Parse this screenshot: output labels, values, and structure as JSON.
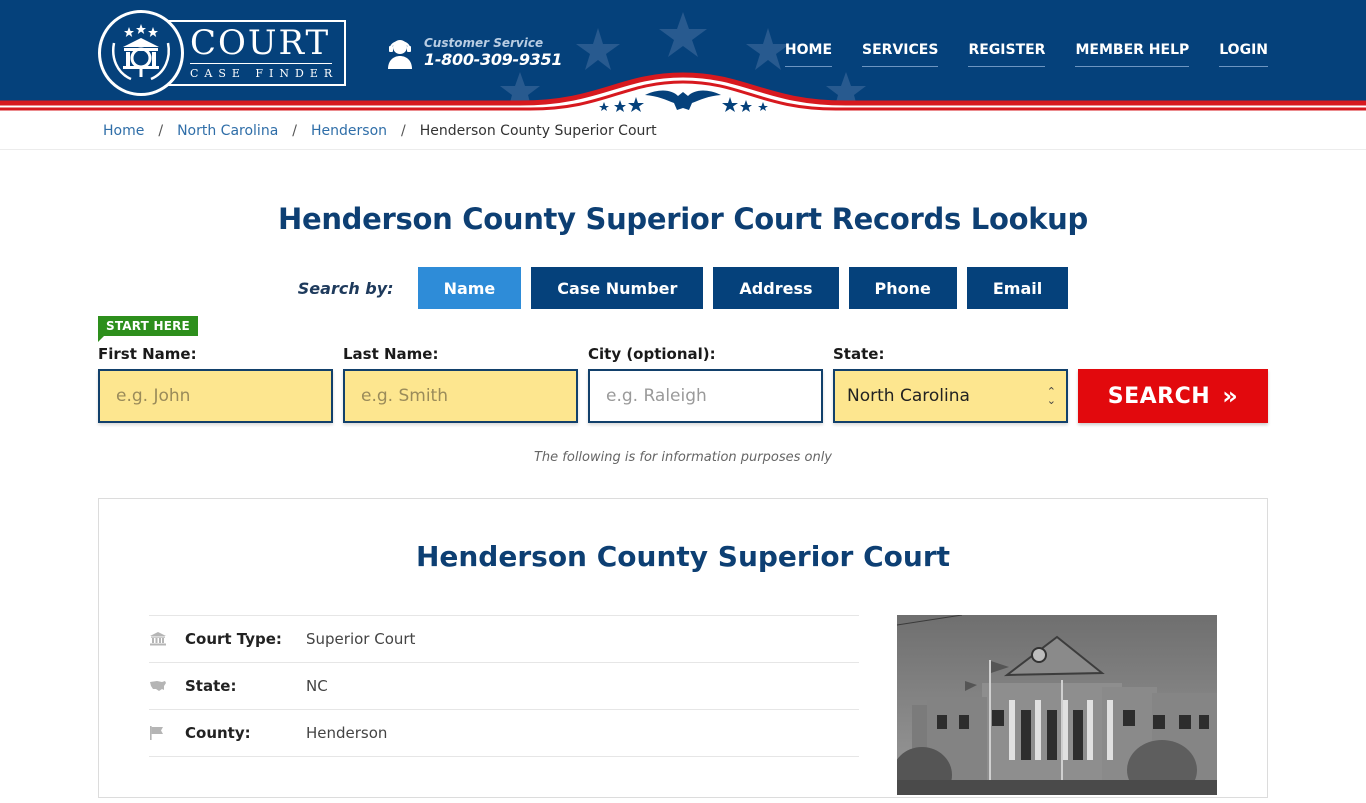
{
  "header": {
    "logo": {
      "title": "COURT",
      "subtitle": "CASE FINDER"
    },
    "customer_service": {
      "label": "Customer Service",
      "phone": "1-800-309-9351"
    },
    "nav": [
      {
        "label": "HOME"
      },
      {
        "label": "SERVICES"
      },
      {
        "label": "REGISTER"
      },
      {
        "label": "MEMBER HELP"
      },
      {
        "label": "LOGIN"
      }
    ]
  },
  "breadcrumb": [
    {
      "label": "Home"
    },
    {
      "label": "North Carolina"
    },
    {
      "label": "Henderson"
    },
    {
      "label": "Henderson County Superior Court"
    }
  ],
  "page_title": "Henderson County Superior Court Records Lookup",
  "search": {
    "search_by_label": "Search by:",
    "tabs": [
      {
        "label": "Name",
        "active": true
      },
      {
        "label": "Case Number",
        "active": false
      },
      {
        "label": "Address",
        "active": false
      },
      {
        "label": "Phone",
        "active": false
      },
      {
        "label": "Email",
        "active": false
      }
    ],
    "start_here": "START HERE",
    "fields": {
      "first_name": {
        "label": "First Name:",
        "placeholder": "e.g. John",
        "value": ""
      },
      "last_name": {
        "label": "Last Name:",
        "placeholder": "e.g. Smith",
        "value": ""
      },
      "city": {
        "label": "City (optional):",
        "placeholder": "e.g.  Raleigh",
        "value": ""
      },
      "state": {
        "label": "State:",
        "value": "North Carolina"
      }
    },
    "button_label": "SEARCH",
    "button_icon": "»"
  },
  "disclaimer": "The following is for information purposes only",
  "court": {
    "title": "Henderson County Superior Court",
    "details": [
      {
        "icon": "courthouse-icon",
        "key": "Court Type:",
        "value": "Superior Court"
      },
      {
        "icon": "usa-map-icon",
        "key": "State:",
        "value": "NC"
      },
      {
        "icon": "flag-icon",
        "key": "County:",
        "value": "Henderson"
      }
    ]
  },
  "colors": {
    "brand_blue": "#05417b",
    "active_tab": "#2e8cd8",
    "search_red": "#e2090d",
    "start_green": "#2d8f1c",
    "input_yellow": "#fde68f"
  }
}
